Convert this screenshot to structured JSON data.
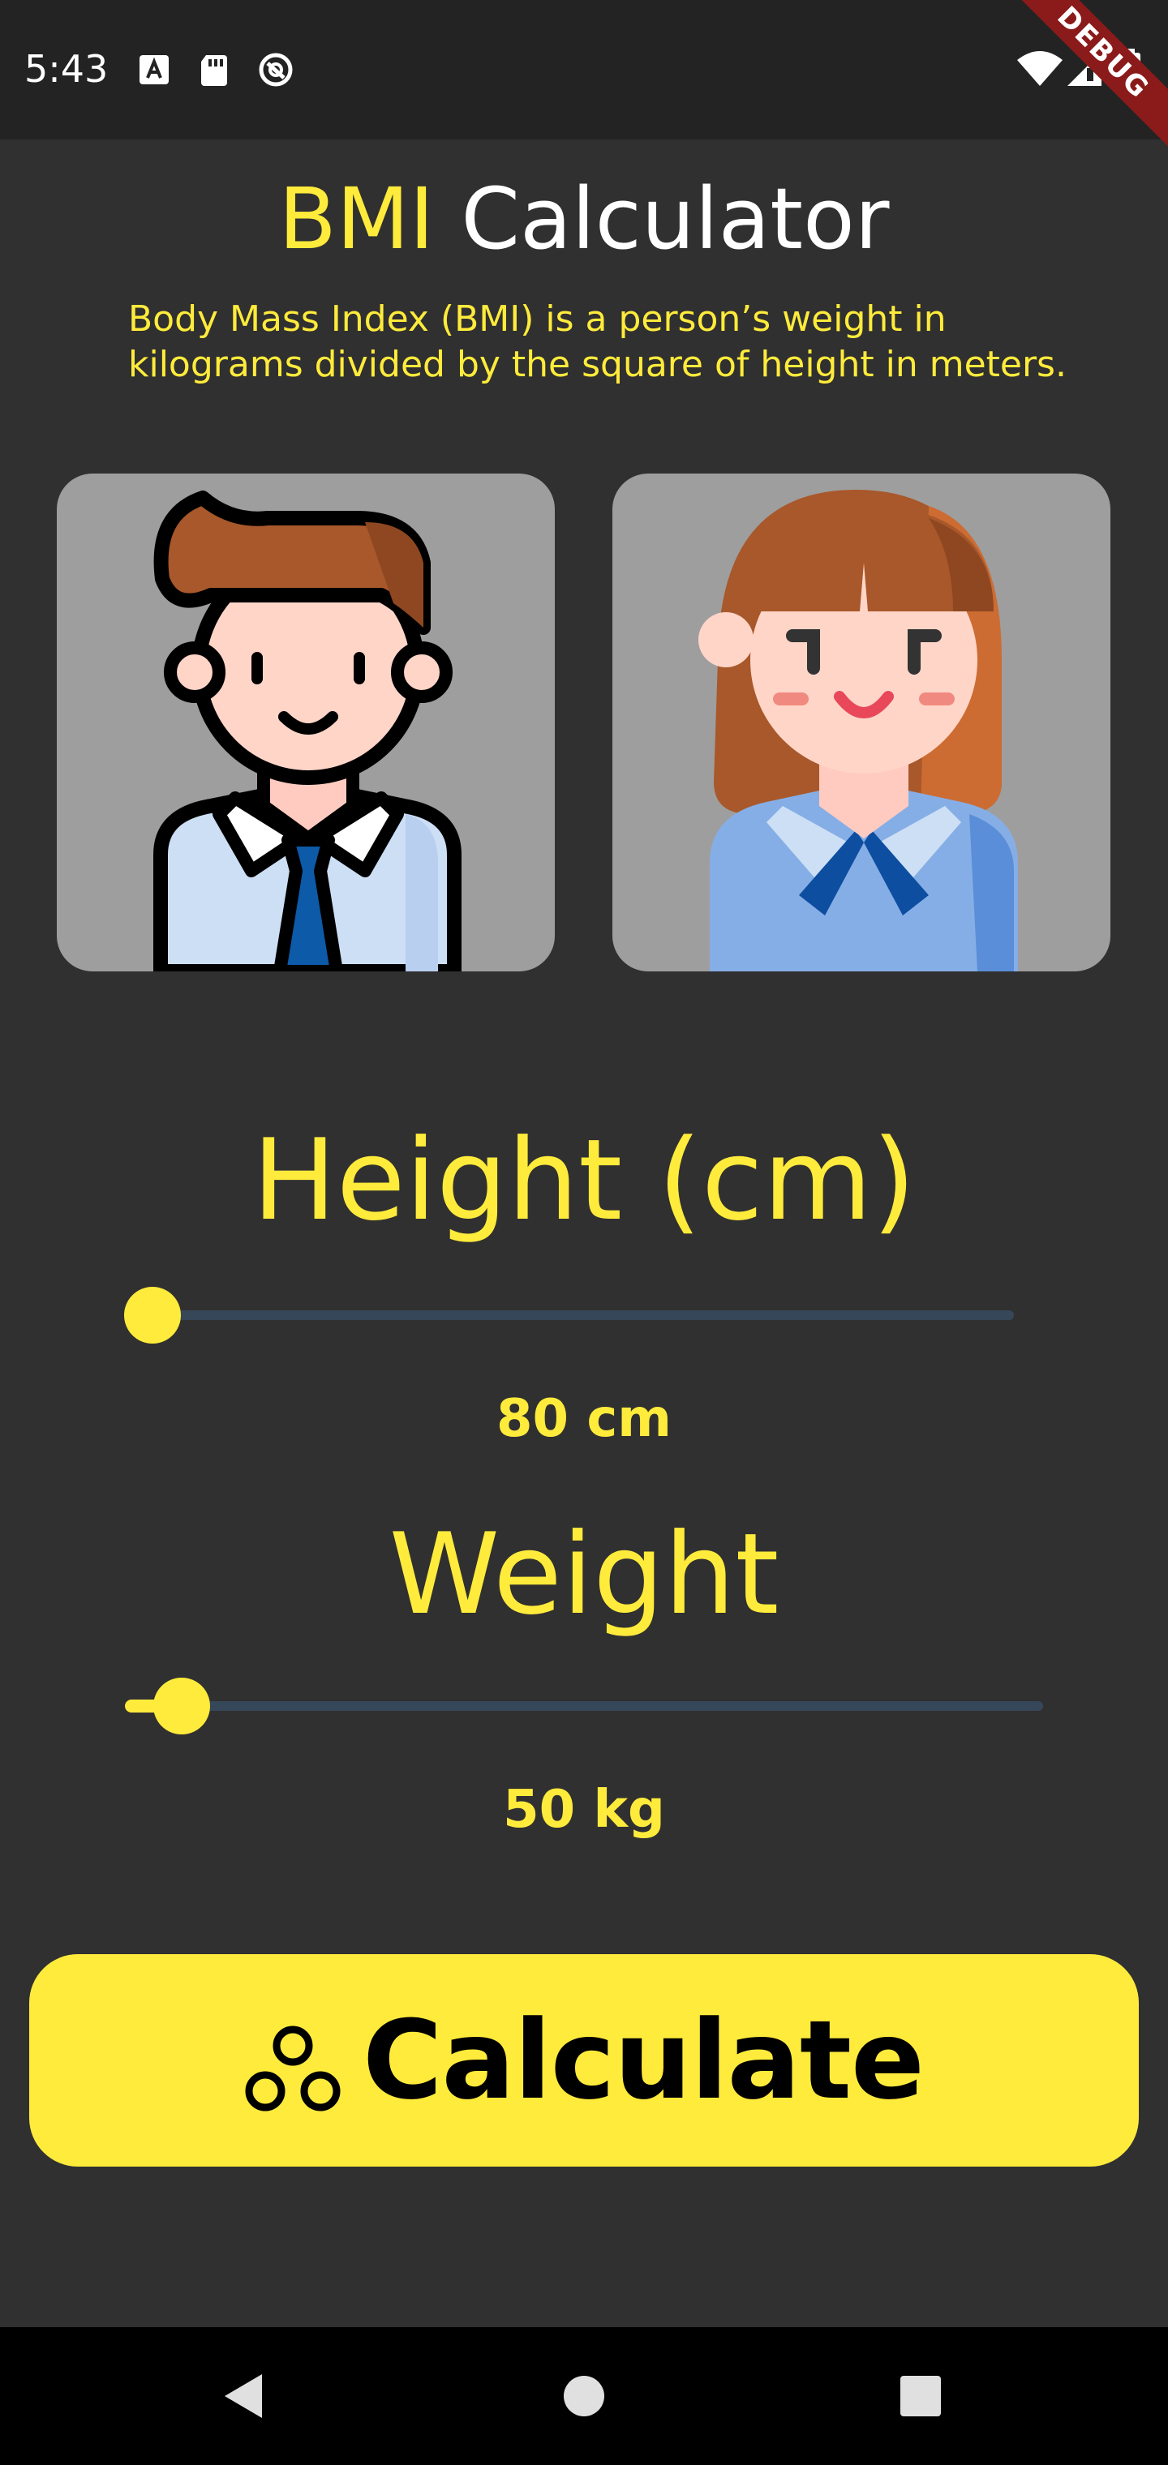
{
  "status_bar": {
    "time": "5:43",
    "left_icons": [
      "text-notification-icon",
      "sd-card-icon",
      "do-not-disturb-icon"
    ],
    "right_icons": [
      "wifi-icon",
      "signal-icon",
      "battery-icon"
    ],
    "debug_banner": "DEBUG"
  },
  "header": {
    "title_accent": "BMI",
    "title_rest": "Calculator",
    "description": "Body Mass Index (BMI) is a person’s weight in kilograms divided by the square of height in meters."
  },
  "gender": {
    "options": [
      "male-avatar",
      "female-avatar"
    ]
  },
  "height": {
    "title": "Height (cm)",
    "value_label": "80 cm",
    "slider_fraction": 0.0
  },
  "weight": {
    "title": "Weight",
    "value_label": "50 kg",
    "slider_fraction": 0.062
  },
  "calculate": {
    "label": "Calculate",
    "icon": "bubbles-icon"
  },
  "nav": {
    "buttons": [
      "back-icon",
      "home-icon",
      "recents-icon"
    ]
  },
  "colors": {
    "accent": "#ffeb3b",
    "background": "#303030",
    "track": "#37475a",
    "card": "#9e9e9e"
  }
}
